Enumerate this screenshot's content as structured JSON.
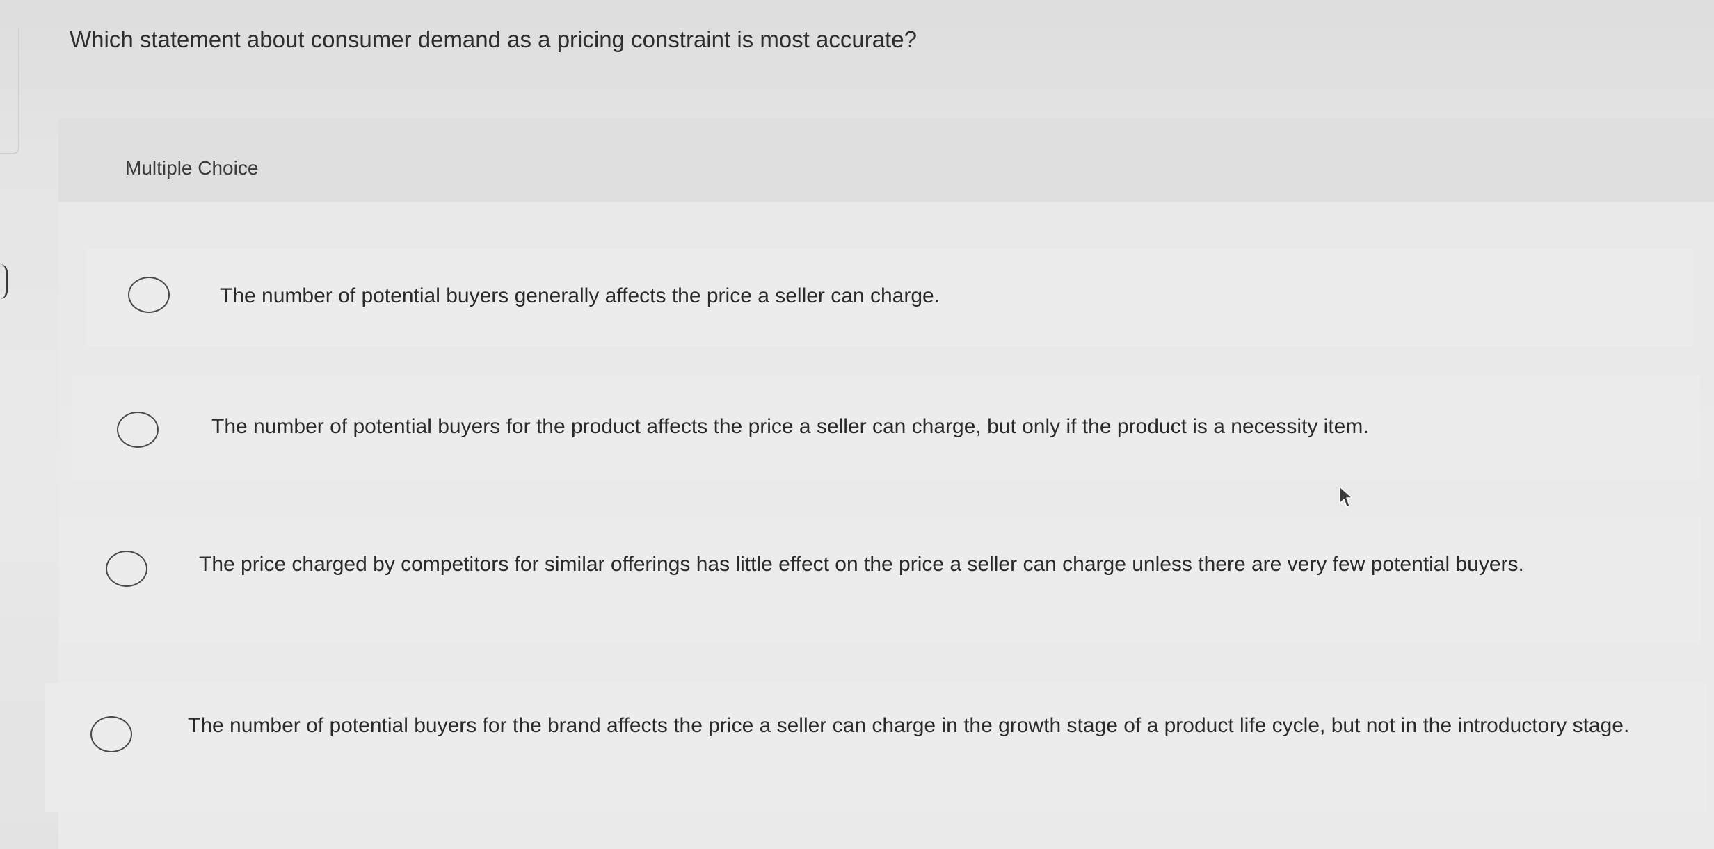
{
  "question": {
    "text": "Which statement about consumer demand as a pricing constraint is most accurate?"
  },
  "section": {
    "label": "Multiple Choice"
  },
  "options": [
    {
      "label": "The number of potential buyers generally affects the price a seller can charge.",
      "selected": false
    },
    {
      "label": "The number of potential buyers for the product affects the price a seller can charge, but only if the product is a necessity item.",
      "selected": false
    },
    {
      "label": "The price charged by competitors for similar offerings has little effect on the price a seller can charge unless there are very few potential buyers.",
      "selected": false
    },
    {
      "label": "The number of potential buyers for the brand affects the price a seller can charge in the growth stage of a product life cycle, but not in the introductory stage.",
      "selected": false
    }
  ],
  "icons": {
    "radio": "radio-unchecked-icon",
    "cursor": "mouse-pointer-icon"
  },
  "colors": {
    "background": "#e6e5e5",
    "option_bg": "#ececec",
    "text": "#2b2b2b",
    "radio_border": "#4a4a4a"
  }
}
